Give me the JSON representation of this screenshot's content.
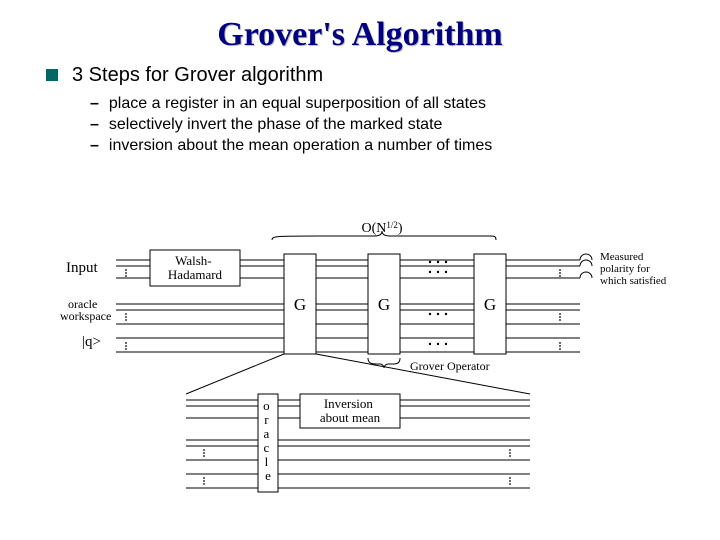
{
  "title": "Grover's Algorithm",
  "main_bullet": "3 Steps for Grover algorithm",
  "sub_bullets": [
    "place a register in an equal superposition of all states",
    "selectively invert the phase of the marked state",
    "inversion about the mean operation a number of times"
  ],
  "diagram": {
    "input_label": "Input",
    "oracle_workspace": "oracle\nworkspace",
    "q_label": "|q>",
    "walsh_hadamard": "Walsh-\nHadamard",
    "g_label": "G",
    "complexity": "O(N",
    "complexity_exp": "1/2",
    "complexity_close": ")",
    "grover_operator": "Grover Operator",
    "measured": "Measured\npolarity for\nwhich satisfied",
    "oracle_vert": "oracle",
    "inversion_box": "Inversion\nabout mean"
  }
}
